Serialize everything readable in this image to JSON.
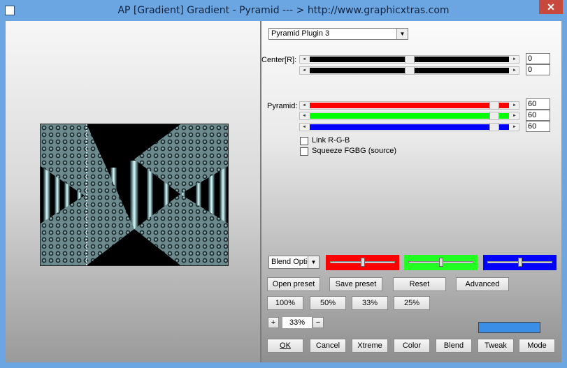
{
  "window": {
    "title": "AP [Gradient]  Gradient - Pyramid     --- > http://www.graphicxtras.com",
    "close_glyph": "✕"
  },
  "plugin_select": {
    "value": "Pyramid Plugin 3",
    "arrow": "▼"
  },
  "center": {
    "label": "Center[R]:",
    "sliders": [
      {
        "value": "0",
        "position": 0.5
      },
      {
        "value": "0",
        "position": 0.5
      }
    ]
  },
  "pyramid": {
    "label": "Pyramid:",
    "sliders": [
      {
        "value": "60",
        "color": "#ff0000",
        "position": 0.94
      },
      {
        "value": "60",
        "color": "#00ff00",
        "position": 0.94
      },
      {
        "value": "60",
        "color": "#0000ff",
        "position": 0.94
      }
    ]
  },
  "checkboxes": {
    "link_rgb": {
      "label": "Link R-G-B",
      "checked": false
    },
    "squeeze": {
      "label": "Squeeze FGBG (source)",
      "checked": false
    }
  },
  "blend": {
    "select_value": "Blend Optio",
    "red": {
      "color": "#ff0000",
      "position": 0.5
    },
    "green": {
      "color": "#22ff22",
      "position": 0.5
    },
    "blue": {
      "color": "#0000ff",
      "position": 0.5
    }
  },
  "preset_buttons": {
    "open": "Open preset",
    "save": "Save preset",
    "reset": "Reset",
    "advanced": "Advanced"
  },
  "zoom_buttons": [
    "100%",
    "50%",
    "33%",
    "25%"
  ],
  "zoom": {
    "plus": "+",
    "value": "33%",
    "minus": "−"
  },
  "color_swatch": "#3b8ee6",
  "bottom_buttons": {
    "ok": "OK",
    "cancel": "Cancel",
    "xtreme": "Xtreme",
    "color": "Color",
    "blend": "Blend",
    "tweak": "Tweak",
    "mode": "Mode"
  }
}
